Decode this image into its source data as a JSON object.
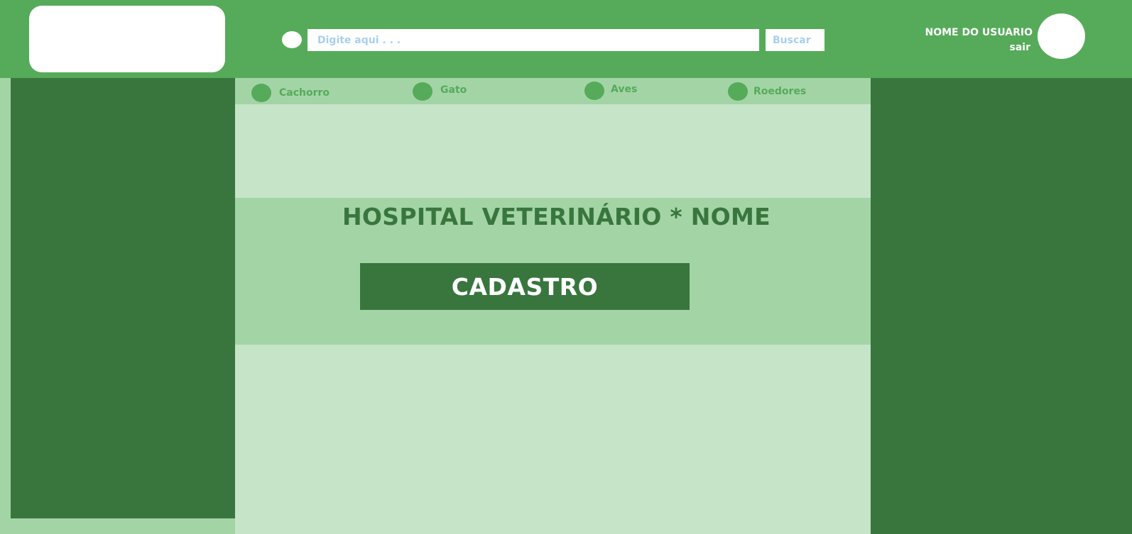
{
  "header": {
    "search": {
      "placeholder": "Digite aqui . . .",
      "button_label": "Buscar"
    },
    "user": {
      "name": "NOME DO USUARIO",
      "logout_label": "sair"
    }
  },
  "categories": [
    {
      "label": "Cachorro"
    },
    {
      "label": "Gato"
    },
    {
      "label": "Aves"
    },
    {
      "label": "Roedores"
    }
  ],
  "hero": {
    "title": "HOSPITAL VETERINÁRIO * NOME",
    "cta_label": "CADASTRO"
  },
  "colors": {
    "primary": "#55ab59",
    "dark": "#38763d",
    "light": "#a3d4a6",
    "lighter": "#c6e4c7",
    "placeholder_text": "#a8cfee"
  }
}
